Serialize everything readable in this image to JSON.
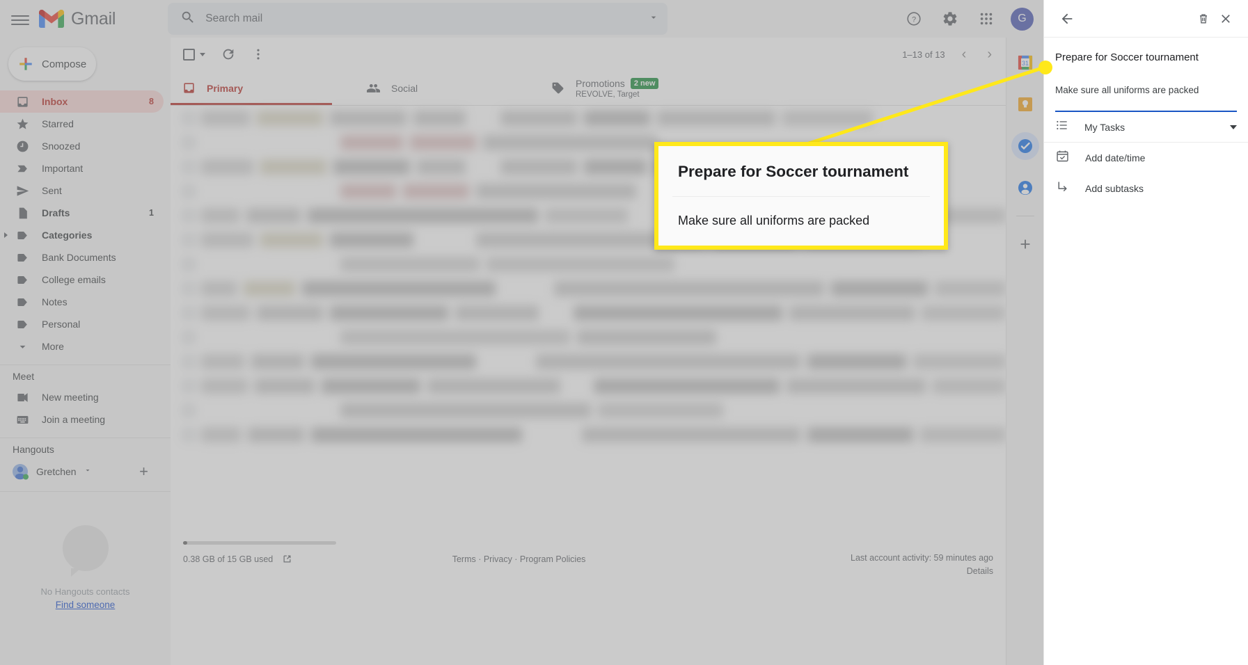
{
  "app": {
    "name": "Gmail"
  },
  "search": {
    "placeholder": "Search mail",
    "value": ""
  },
  "topbar": {
    "menu_label": "Main menu",
    "help_label": "Support",
    "settings_label": "Settings",
    "apps_label": "Google apps",
    "avatar_initial": "G"
  },
  "sidebar": {
    "compose_label": "Compose",
    "items": [
      {
        "label": "Inbox",
        "count": "8",
        "icon": "inbox-icon",
        "active": true
      },
      {
        "label": "Starred",
        "count": "",
        "icon": "star-icon"
      },
      {
        "label": "Snoozed",
        "count": "",
        "icon": "clock-icon"
      },
      {
        "label": "Important",
        "count": "",
        "icon": "important-icon"
      },
      {
        "label": "Sent",
        "count": "",
        "icon": "send-icon"
      },
      {
        "label": "Drafts",
        "count": "1",
        "icon": "draft-icon",
        "bold": true
      },
      {
        "label": "Categories",
        "count": "",
        "icon": "label-icon",
        "bold": true,
        "expandable": true
      },
      {
        "label": "Bank Documents",
        "count": "",
        "icon": "label-icon"
      },
      {
        "label": "College emails",
        "count": "",
        "icon": "label-icon"
      },
      {
        "label": "Notes",
        "count": "",
        "icon": "label-icon"
      },
      {
        "label": "Personal",
        "count": "",
        "icon": "label-icon"
      },
      {
        "label": "More",
        "count": "",
        "icon": "chevron-down-icon"
      }
    ],
    "meet": {
      "title": "Meet",
      "items": [
        {
          "label": "New meeting",
          "icon": "video-camera-icon"
        },
        {
          "label": "Join a meeting",
          "icon": "keyboard-icon"
        }
      ]
    },
    "hangouts": {
      "title": "Hangouts",
      "user": "Gretchen",
      "empty_text": "No Hangouts contacts",
      "find_link": "Find someone"
    }
  },
  "toolbar": {
    "select_all_label": "Select",
    "refresh_label": "Refresh",
    "more_label": "More options",
    "pager_text": "1–13 of 13",
    "prev_label": "Newer",
    "next_label": "Older"
  },
  "tabs": [
    {
      "label": "Primary",
      "icon": "inbox-icon",
      "active": true,
      "sub": "",
      "badge": ""
    },
    {
      "label": "Social",
      "icon": "people-icon",
      "active": false,
      "sub": "",
      "badge": ""
    },
    {
      "label": "Promotions",
      "icon": "tag-icon",
      "active": false,
      "sub": "REVOLVE, Target",
      "badge": "2 new"
    }
  ],
  "mail_list": {
    "blurred": true,
    "row_count": 14
  },
  "footer": {
    "storage_text": "0.38 GB of 15 GB used",
    "storage_percent": 2.5,
    "links": "Terms · Privacy · Program Policies",
    "activity": "Last account activity: 59 minutes ago",
    "details": "Details"
  },
  "app_rail": {
    "items": [
      {
        "name": "calendar-icon",
        "label": "Calendar",
        "selected": false
      },
      {
        "name": "keep-icon",
        "label": "Keep",
        "selected": false
      },
      {
        "name": "tasks-icon",
        "label": "Tasks",
        "selected": true
      },
      {
        "name": "contacts-icon",
        "label": "Contacts",
        "selected": false
      }
    ],
    "add_label": "Get add-ons"
  },
  "task_panel": {
    "back_label": "Back",
    "delete_label": "Delete task",
    "close_label": "Close",
    "title": "Prepare for Soccer tournament",
    "notes": "Make sure all uniforms are packed",
    "list_name": "My Tasks",
    "add_date_label": "Add date/time",
    "add_subtasks_label": "Add subtasks"
  },
  "callout": {
    "title": "Prepare for Soccer tournament",
    "subtitle": "Make sure all uniforms are packed",
    "border_color": "#ffe81a"
  },
  "colors": {
    "accent_red": "#b8312b",
    "accent_blue": "#1a56c4",
    "highlight_yellow": "#ffe81a",
    "badge_green": "#1e8e3e"
  }
}
